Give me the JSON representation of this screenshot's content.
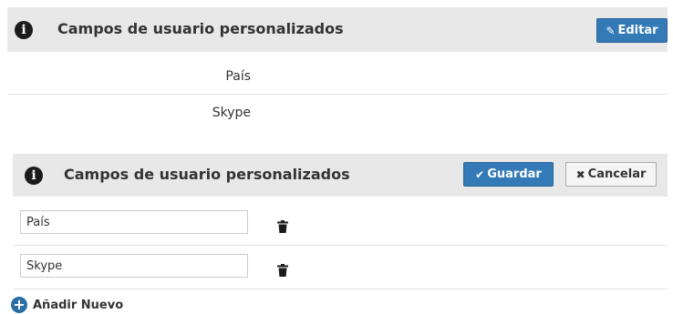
{
  "view_panel": {
    "title": "Campos de usuario personalizados",
    "edit_label": "Editar",
    "fields": [
      "País",
      "Skype"
    ]
  },
  "edit_panel": {
    "title": "Campos de usuario personalizados",
    "save_label": "Guardar",
    "cancel_label": "Cancelar",
    "fields": [
      {
        "value": "País"
      },
      {
        "value": "Skype"
      }
    ],
    "add_new_label": "Añadir Nuevo"
  },
  "icons": {
    "info": "info-icon",
    "edit": "pencil-icon",
    "save": "check-icon",
    "cancel": "x-icon",
    "delete": "trash-icon",
    "add": "plus-circle-icon"
  },
  "colors": {
    "header_bg": "#e8e8e8",
    "primary_button": "#337ab7",
    "add_icon": "#2c6ea3"
  }
}
